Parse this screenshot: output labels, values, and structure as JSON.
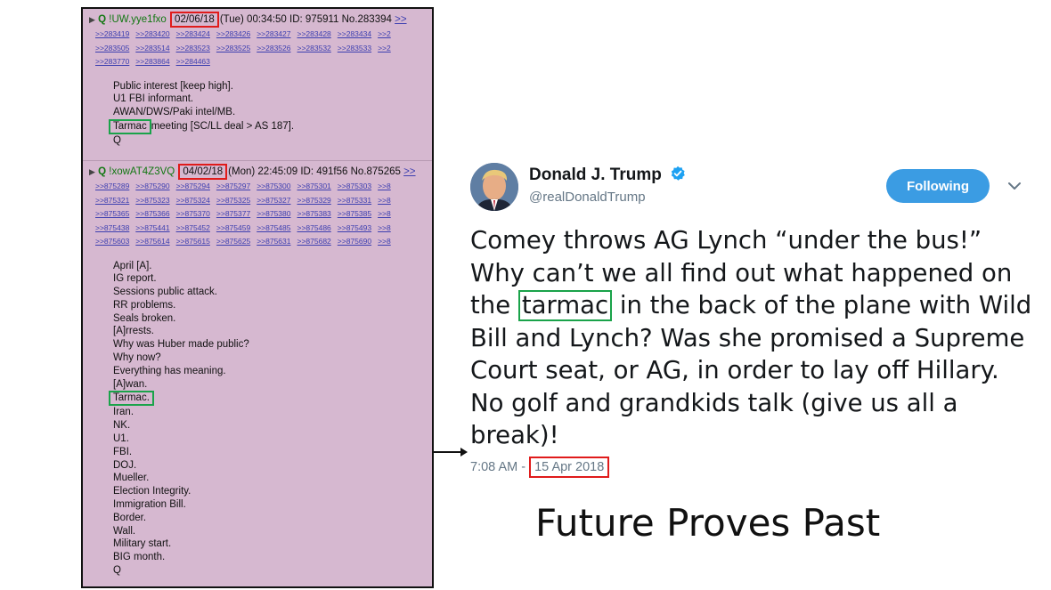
{
  "post1": {
    "marker": "Q",
    "trip": "!UW.yye1fxo",
    "date": "02/06/18",
    "meta": "(Tue) 00:34:50 ID: 975911 No.283394",
    "overflow_link": ">>",
    "ref_rows": [
      [
        ">>283419",
        ">>283420",
        ">>283424",
        ">>283426",
        ">>283427",
        ">>283428",
        ">>283434",
        ">>2"
      ],
      [
        ">>283505",
        ">>283514",
        ">>283523",
        ">>283525",
        ">>283526",
        ">>283532",
        ">>283533",
        ">>2"
      ],
      [
        ">>283770",
        ">>283864",
        ">>284463"
      ]
    ],
    "lines": [
      "Public interest [keep high].",
      "U1 FBI informant.",
      "AWAN/DWS/Paki intel/MB."
    ],
    "tarmac": "Tarmac",
    "tarmac_rest": "meeting [SC/LL deal > AS 187].",
    "signature": "Q"
  },
  "post2": {
    "marker": "Q",
    "trip": "!xowAT4Z3VQ",
    "date": "04/02/18",
    "meta": "(Mon) 22:45:09 ID: 491f56 No.875265",
    "overflow_link": ">>",
    "ref_rows": [
      [
        ">>875289",
        ">>875290",
        ">>875294",
        ">>875297",
        ">>875300",
        ">>875301",
        ">>875303",
        ">>8"
      ],
      [
        ">>875321",
        ">>875323",
        ">>875324",
        ">>875325",
        ">>875327",
        ">>875329",
        ">>875331",
        ">>8"
      ],
      [
        ">>875365",
        ">>875366",
        ">>875370",
        ">>875377",
        ">>875380",
        ">>875383",
        ">>875385",
        ">>8"
      ],
      [
        ">>875438",
        ">>875441",
        ">>875452",
        ">>875459",
        ">>875485",
        ">>875486",
        ">>875493",
        ">>8"
      ],
      [
        ">>875603",
        ">>875614",
        ">>875615",
        ">>875625",
        ">>875631",
        ">>875682",
        ">>875690",
        ">>8"
      ]
    ],
    "lines_before": [
      "April [A].",
      "IG report.",
      "Sessions public attack.",
      "RR problems.",
      "Seals broken.",
      "[A]rrests.",
      "Why was Huber made public?",
      "Why now?",
      "Everything has meaning.",
      "[A]wan."
    ],
    "tarmac": "Tarmac.",
    "lines_after": [
      "Iran.",
      "NK.",
      "U1.",
      "FBI.",
      "DOJ.",
      "Mueller.",
      "Election Integrity.",
      "Immigration Bill.",
      "Border.",
      "Wall.",
      "Military start.",
      "BIG month.",
      "Q"
    ]
  },
  "tweet": {
    "display_name": "Donald J. Trump",
    "handle": "@realDonaldTrump",
    "follow_label": "Following",
    "text_lines": [
      "Comey throws AG Lynch “under the bus!”",
      "Why can’t we all find out what happened on"
    ],
    "line3_before": "the ",
    "tarmac": "tarmac",
    "line3_after": " in the back of the plane with Wild",
    "text_lines_end": [
      "Bill and Lynch? Was she promised a Supreme",
      "Court seat, or AG, in order to lay off Hillary.",
      "No golf and grandkids talk (give us all a",
      "break)!"
    ],
    "time": "7:08 AM - ",
    "date": "15 Apr 2018"
  },
  "caption": "Future Proves Past",
  "colors": {
    "forum_bg": "#d6b8d0",
    "link": "#3d3fb0",
    "highlight_red": "#e01b1b",
    "highlight_green": "#1aa34a",
    "follow_blue": "#3b9ce3"
  }
}
